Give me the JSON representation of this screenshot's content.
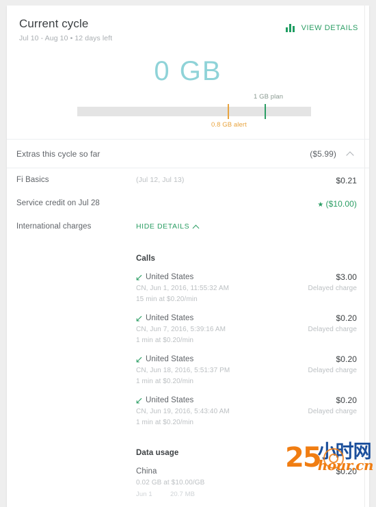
{
  "cycle": {
    "title": "Current cycle",
    "subtitle": "Jul 10 - Aug 10 • 12 days left",
    "view_details_label": "VIEW DETAILS",
    "view_details_icon": "bar-chart-icon",
    "usage_display": "0 GB",
    "usage_value_gb": 0,
    "plan_marker_label": "1 GB plan",
    "plan_marker_gb": 1,
    "alert_marker_label": "0.8 GB alert",
    "alert_marker_gb": 0.8,
    "meter_max_gb": 1.28,
    "colors": {
      "usage_text": "#8fd3d8",
      "plan_marker": "#2a9d63",
      "alert_marker": "#e8a33d",
      "track": "#e4e4e4",
      "accent_green": "#2a9d63"
    }
  },
  "extras": {
    "header_label": "Extras this cycle so far",
    "header_amount": "($5.99)",
    "collapse_icon": "chevron-up-icon",
    "rows": [
      {
        "name": "Fi Basics",
        "mid": "(Jul 12, Jul 13)",
        "amount": "$0.21",
        "is_credit": false,
        "has_star": false
      },
      {
        "name": "Service credit on Jul 28",
        "mid": "",
        "amount": "($10.00)",
        "is_credit": true,
        "has_star": true,
        "star_icon": "star-icon"
      },
      {
        "name": "International charges",
        "mid": "HIDE DETAILS",
        "amount": "",
        "is_credit": false,
        "has_star": false,
        "toggle_icon": "chevron-up-icon"
      }
    ]
  },
  "details": {
    "calls": {
      "heading": "Calls",
      "items": [
        {
          "icon": "outgoing-call-arrow-icon",
          "title": "United States",
          "meta_line1": "CN, Jun 1, 2016, 11:55:32 AM",
          "meta_line2": "15 min at $0.20/min",
          "amount": "$3.00",
          "note": "Delayed charge"
        },
        {
          "icon": "outgoing-call-arrow-icon",
          "title": "United States",
          "meta_line1": "CN, Jun 7, 2016, 5:39:16 AM",
          "meta_line2": "1 min at $0.20/min",
          "amount": "$0.20",
          "note": "Delayed charge"
        },
        {
          "icon": "outgoing-call-arrow-icon",
          "title": "United States",
          "meta_line1": "CN, Jun 18, 2016, 5:51:37 PM",
          "meta_line2": "1 min at $0.20/min",
          "amount": "$0.20",
          "note": "Delayed charge"
        },
        {
          "icon": "outgoing-call-arrow-icon",
          "title": "United States",
          "meta_line1": "CN, Jun 19, 2016, 5:43:40 AM",
          "meta_line2": "1 min at $0.20/min",
          "amount": "$0.20",
          "note": "Delayed charge"
        }
      ]
    },
    "data_usage": {
      "heading": "Data usage",
      "items": [
        {
          "title": "China",
          "meta_line1": "0.02 GB at $10.00/GB",
          "sub_date": "Jun 1",
          "sub_amount": "20.7 MB",
          "amount": "$0.20"
        }
      ]
    }
  },
  "watermark": {
    "number": "25",
    "cn_text": "小时网",
    "latin_text": "hour.cn"
  }
}
